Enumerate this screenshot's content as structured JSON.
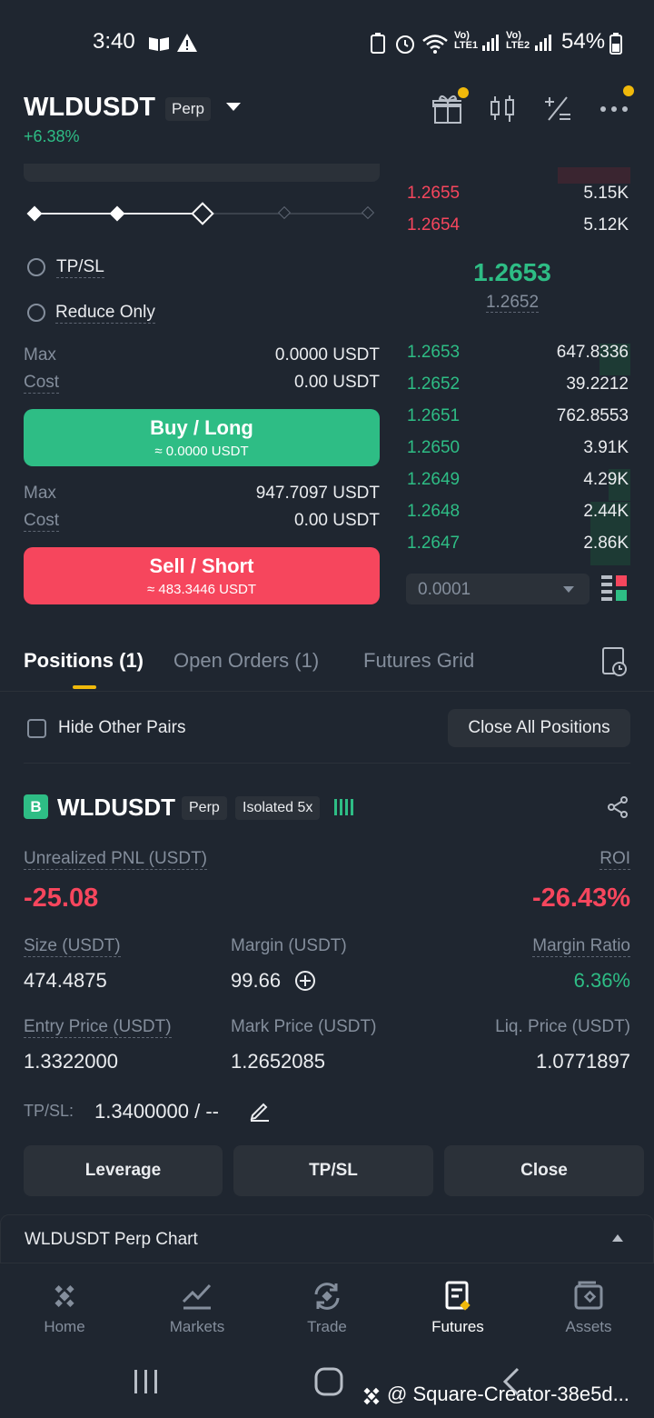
{
  "status_bar": {
    "time": "3:40",
    "net1": "Vo)\nLTE1",
    "net2": "Vo)\nLTE2",
    "battery": "54%"
  },
  "header": {
    "pair": "WLDUSDT",
    "type_tag": "Perp",
    "change": "+6.38%",
    "icons": [
      "gift-icon",
      "candlestick-icon",
      "calculator-icon",
      "more-icon"
    ],
    "badge_color": "#f0b90b"
  },
  "order_form": {
    "tpsl_label": "TP/SL",
    "reduce_only_label": "Reduce Only",
    "buy": {
      "max_label": "Max",
      "max_value": "0.0000 USDT",
      "cost_label": "Cost",
      "cost_value": "0.00 USDT",
      "button_label": "Buy / Long",
      "button_sub": "≈ 0.0000 USDT"
    },
    "sell": {
      "max_label": "Max",
      "max_value": "947.7097 USDT",
      "cost_label": "Cost",
      "cost_value": "0.00 USDT",
      "button_label": "Sell / Short",
      "button_sub": "≈ 483.3446 USDT"
    }
  },
  "order_book": {
    "asks": [
      {
        "price": "1.2655",
        "qty": "5.15K"
      },
      {
        "price": "1.2654",
        "qty": "5.12K"
      }
    ],
    "last_price": "1.2653",
    "mark_price": "1.2652",
    "bids": [
      {
        "price": "1.2653",
        "qty": "647.8336"
      },
      {
        "price": "1.2652",
        "qty": "39.2212"
      },
      {
        "price": "1.2651",
        "qty": "762.8553"
      },
      {
        "price": "1.2650",
        "qty": "3.91K"
      },
      {
        "price": "1.2649",
        "qty": "4.29K"
      },
      {
        "price": "1.2648",
        "qty": "2.44K"
      },
      {
        "price": "1.2647",
        "qty": "2.86K"
      }
    ],
    "precision": "0.0001"
  },
  "tabs": {
    "positions": "Positions (1)",
    "open_orders": "Open Orders (1)",
    "futures_grid": "Futures Grid"
  },
  "filters": {
    "hide_other_pairs": "Hide Other Pairs",
    "close_all": "Close All Positions"
  },
  "position": {
    "side_badge": "B",
    "symbol": "WLDUSDT",
    "type_tag": "Perp",
    "margin_tag": "Isolated 5x",
    "unrealized_pnl_label": "Unrealized PNL (USDT)",
    "unrealized_pnl": "-25.08",
    "roi_label": "ROI",
    "roi": "-26.43%",
    "size_label": "Size (USDT)",
    "size": "474.4875",
    "margin_label": "Margin (USDT)",
    "margin": "99.66",
    "margin_ratio_label": "Margin Ratio",
    "margin_ratio": "6.36%",
    "entry_label": "Entry Price (USDT)",
    "entry": "1.3322000",
    "mark_label": "Mark Price (USDT)",
    "mark": "1.2652085",
    "liq_label": "Liq. Price (USDT)",
    "liq": "1.0771897",
    "tpsl_label": "TP/SL:",
    "tpsl_value": "1.3400000 / --",
    "buttons": {
      "leverage": "Leverage",
      "tpsl": "TP/SL",
      "close": "Close"
    }
  },
  "chart_bar": {
    "label": "WLDUSDT Perp Chart"
  },
  "bottom_nav": [
    {
      "label": "Home",
      "icon": "binance-logo-icon"
    },
    {
      "label": "Markets",
      "icon": "markets-icon"
    },
    {
      "label": "Trade",
      "icon": "trade-icon"
    },
    {
      "label": "Futures",
      "icon": "futures-icon"
    },
    {
      "label": "Assets",
      "icon": "wallet-icon"
    }
  ],
  "watermark": "@ Square-Creator-38e5d..."
}
